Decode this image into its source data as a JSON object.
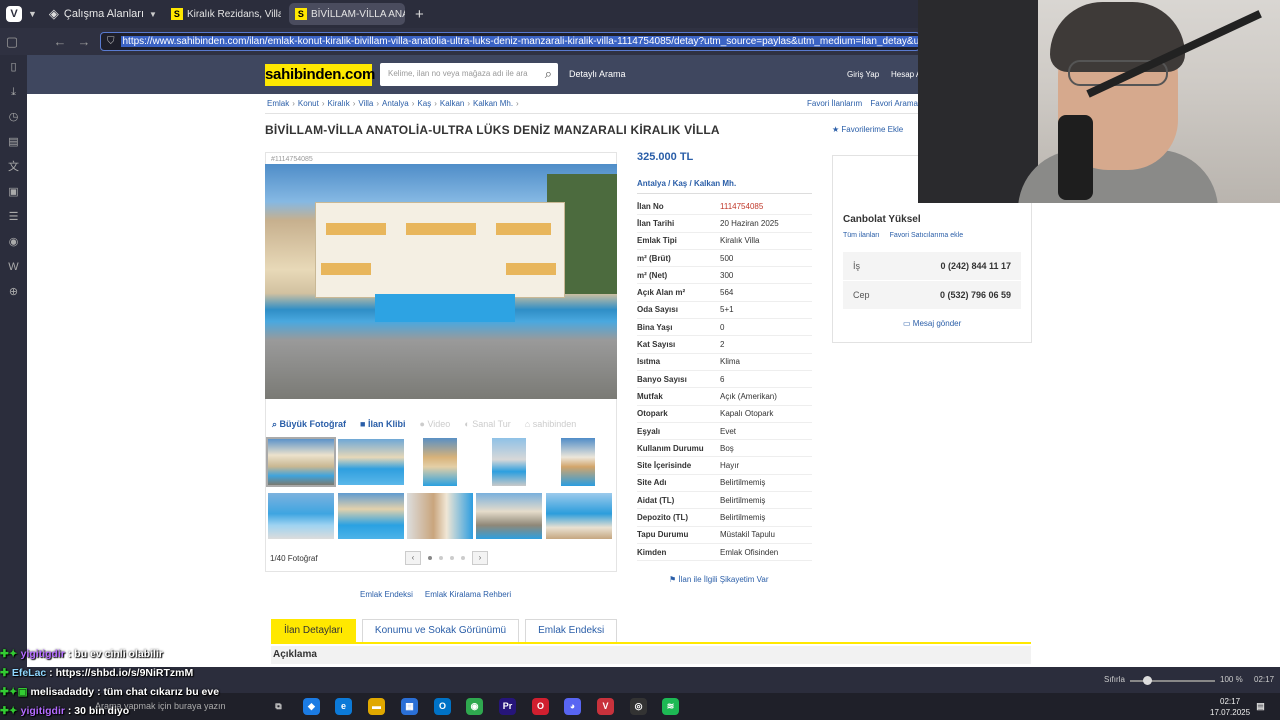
{
  "browser": {
    "workspace": "Çalışma Alanları",
    "tabs": [
      {
        "label": "Kiralık Rezidans, Villa, Müst",
        "favicon": "S",
        "active": false
      },
      {
        "label": "BİVİLLAM-VİLLA ANATOLİ",
        "favicon": "S",
        "active": true
      }
    ],
    "url": "https://www.sahibinden.com/ilan/emlak-konut-kiralik-bivillam-villa-anatolia-ultra-luks-deniz-manzarali-kiralik-villa-1114754085/detay?utm_source=paylas&utm_medium=ilan_detay&utm_campaign=sahibi"
  },
  "site": {
    "logo": "sahibinden.com",
    "search_placeholder": "Kelime, ilan no veya mağaza adı ile ara",
    "detayli": "Detaylı Arama",
    "login": "Giriş Yap",
    "account": "Hesap A",
    "breadcrumbs": [
      "Emlak",
      "Konut",
      "Kiralık",
      "Villa",
      "Antalya",
      "Kaş",
      "Kalkan",
      "Kalkan Mh."
    ],
    "fav_links": [
      "Favori İlanlarım",
      "Favori Aramalar"
    ]
  },
  "listing": {
    "title": "BİVİLLAM-VİLLA ANATOLİA-ULTRA LÜKS DENİZ MANZARALI KİRALIK VİLLA",
    "add_favorite": "Favorilerime Ekle",
    "id_small": "#1114754085",
    "price": "325.000 TL",
    "location": [
      "Antalya",
      "Kaş",
      "Kalkan Mh."
    ],
    "media_tabs": [
      "Büyük Fotoğraf",
      "İlan Klibi",
      "Video",
      "Sanal Tur",
      "sahibinden"
    ],
    "photo_count": "1/40 Fotoğraf",
    "below_links": [
      "Emlak Endeksi",
      "Emlak Kiralama Rehberi"
    ],
    "complaint": "İlan ile İlgili Şikayetim Var",
    "details": [
      {
        "k": "İlan No",
        "v": "1114754085"
      },
      {
        "k": "İlan Tarihi",
        "v": "20 Haziran 2025"
      },
      {
        "k": "Emlak Tipi",
        "v": "Kiralık Villa"
      },
      {
        "k": "m² (Brüt)",
        "v": "500"
      },
      {
        "k": "m² (Net)",
        "v": "300"
      },
      {
        "k": "Açık Alan m²",
        "v": "564"
      },
      {
        "k": "Oda Sayısı",
        "v": "5+1"
      },
      {
        "k": "Bina Yaşı",
        "v": "0"
      },
      {
        "k": "Kat Sayısı",
        "v": "2"
      },
      {
        "k": "Isıtma",
        "v": "Klima"
      },
      {
        "k": "Banyo Sayısı",
        "v": "6"
      },
      {
        "k": "Mutfak",
        "v": "Açık (Amerikan)"
      },
      {
        "k": "Otopark",
        "v": "Kapalı Otopark"
      },
      {
        "k": "Eşyalı",
        "v": "Evet"
      },
      {
        "k": "Kullanım Durumu",
        "v": "Boş"
      },
      {
        "k": "Site İçerisinde",
        "v": "Hayır"
      },
      {
        "k": "Site Adı",
        "v": "Belirtilmemiş"
      },
      {
        "k": "Aidat (TL)",
        "v": "Belirtilmemiş"
      },
      {
        "k": "Depozito (TL)",
        "v": "Belirtilmemiş"
      },
      {
        "k": "Tapu Durumu",
        "v": "Müstakil Tapulu"
      },
      {
        "k": "Kimden",
        "v": "Emlak Ofisinden"
      }
    ]
  },
  "seller": {
    "name": "Canbolat Yüksel",
    "all_ads": "Tüm ilanları",
    "fav_seller": "Favori Satıcılarıma ekle",
    "phones": [
      {
        "label": "İş",
        "number": "0 (242) 844 11 17"
      },
      {
        "label": "Cep",
        "number": "0 (532) 796 06 59"
      }
    ],
    "message": "Mesaj gönder"
  },
  "page_tabs": [
    "İlan Detayları",
    "Konumu ve Sokak Görünümü",
    "Emlak Endeksi"
  ],
  "section_title": "Açıklama",
  "status": {
    "zoom_label": "Sıfırla",
    "zoom": "100 %",
    "time": "02:17"
  },
  "taskbar": {
    "search": "Arama yapmak için buraya yazın",
    "time": "02:17",
    "date": "17.07.2025"
  },
  "chat": [
    {
      "user": "yigitigdir",
      "msg": "bu ev cinli olabilir"
    },
    {
      "user": "EfeLac",
      "msg": "https://shbd.io/s/9NiRTzmM"
    },
    {
      "user": "melisadaddy",
      "msg": "tüm chat cıkarız bu eve"
    },
    {
      "user": "yigitigdir",
      "msg": "30 bin diyo"
    }
  ]
}
